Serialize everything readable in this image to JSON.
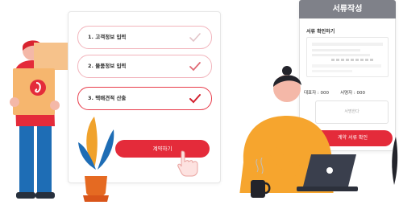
{
  "checklist": {
    "steps": [
      {
        "label": "1. 고객정보 입력",
        "state": "done"
      },
      {
        "label": "2. 물품정보 입력",
        "state": "done"
      },
      {
        "label": "3. 택배견적 산출",
        "state": "active"
      }
    ],
    "contract_button": "계약하기"
  },
  "document_panel": {
    "title": "서류작성",
    "check_label": "서류 확인하기",
    "representative_label": "대표자 : 000",
    "signer_label": "서명자 : 000",
    "signature_placeholder": "서명한다",
    "confirm_button": "계약 서류 확인"
  },
  "colors": {
    "accent": "#e42b3a",
    "step_border": "#f2b4bc",
    "header_gray": "#7f8189"
  }
}
